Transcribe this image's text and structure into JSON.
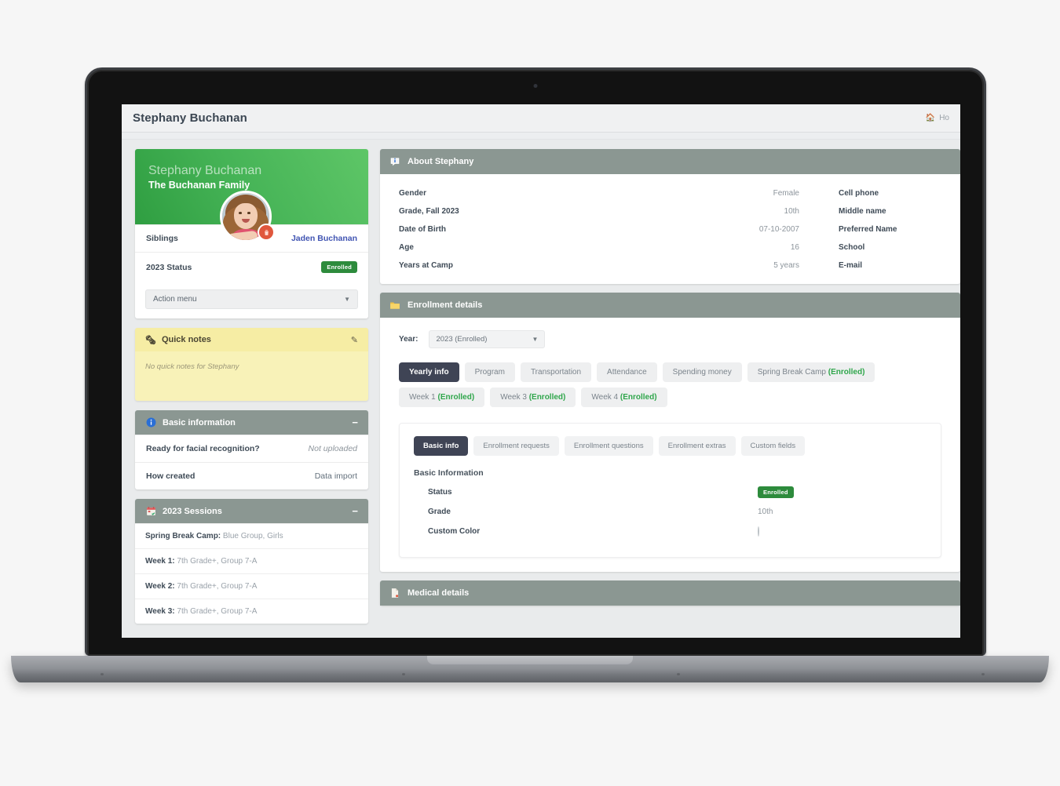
{
  "topbar": {
    "title": "Stephany Buchanan",
    "home_icon": "home-icon",
    "breadcrumb_text": "Ho"
  },
  "profile": {
    "name": "Stephany Buchanan",
    "family": "The Buchanan Family",
    "avatar_alt": "Stephany Buchanan photo",
    "delete_icon": "trash-icon",
    "rows": [
      {
        "key": "Siblings",
        "value": "Jaden Buchanan",
        "type": "link"
      },
      {
        "key": "2023 Status",
        "value": "Enrolled",
        "type": "badge"
      }
    ],
    "action_menu": {
      "label": "Action menu",
      "caret": "chevron-down-icon"
    }
  },
  "quick_notes": {
    "icon": "notepad-icon",
    "title": "Quick notes",
    "edit_icon": "edit-icon",
    "empty_text": "No quick notes for Stephany"
  },
  "basic_information": {
    "icon": "info-circle-icon",
    "title": "Basic information",
    "collapse": "−",
    "rows": [
      {
        "key": "Ready for facial recognition?",
        "value": "Not uploaded",
        "muted": true
      },
      {
        "key": "How created",
        "value": "Data import",
        "muted": false
      }
    ]
  },
  "sessions": {
    "icon": "calendar-icon",
    "title": "2023 Sessions",
    "collapse": "−",
    "rows": [
      {
        "label": "Spring Break Camp:",
        "detail": "Blue Group, Girls"
      },
      {
        "label": "Week 1:",
        "detail": "7th Grade+, Group 7-A"
      },
      {
        "label": "Week 2:",
        "detail": "7th Grade+, Group 7-A"
      },
      {
        "label": "Week 3:",
        "detail": "7th Grade+, Group 7-A"
      }
    ]
  },
  "about": {
    "icon": "speech-bubble-info-icon",
    "title": "About Stephany",
    "rows": [
      {
        "label": "Gender",
        "value": "Female",
        "label2": "Cell phone",
        "value2": ""
      },
      {
        "label": "Grade, Fall 2023",
        "value": "10th",
        "label2": "Middle name",
        "value2": ""
      },
      {
        "label": "Date of Birth",
        "value": "07-10-2007",
        "label2": "Preferred Name",
        "value2": ""
      },
      {
        "label": "Age",
        "value": "16",
        "label2": "School",
        "value2": ""
      },
      {
        "label": "Years at Camp",
        "value": "5 years",
        "label2": "E-mail",
        "value2": ""
      }
    ]
  },
  "enrollment": {
    "icon": "folder-icon",
    "title": "Enrollment details",
    "year_label": "Year:",
    "year_value": "2023 (Enrolled)",
    "year_caret": "chevron-down-icon",
    "tabs": [
      {
        "label": "Yearly info",
        "note": "",
        "active": true
      },
      {
        "label": "Program",
        "note": "",
        "active": false
      },
      {
        "label": "Transportation",
        "note": "",
        "active": false
      },
      {
        "label": "Attendance",
        "note": "",
        "active": false
      },
      {
        "label": "Spending money",
        "note": "",
        "active": false
      },
      {
        "label": "Spring Break Camp",
        "note": "(Enrolled)",
        "active": false
      },
      {
        "label": "Week 1",
        "note": "(Enrolled)",
        "active": false
      },
      {
        "label": "Week 3",
        "note": "(Enrolled)",
        "active": false
      },
      {
        "label": "Week 4",
        "note": "(Enrolled)",
        "active": false
      }
    ],
    "inner_tabs": [
      {
        "label": "Basic info",
        "active": true
      },
      {
        "label": "Enrollment requests",
        "active": false
      },
      {
        "label": "Enrollment questions",
        "active": false
      },
      {
        "label": "Enrollment extras",
        "active": false
      },
      {
        "label": "Custom fields",
        "active": false
      }
    ],
    "basic_info_heading": "Basic Information",
    "basic_info_rows": [
      {
        "label": "Status",
        "value": "Enrolled",
        "type": "badge"
      },
      {
        "label": "Grade",
        "value": "10th",
        "type": "text"
      },
      {
        "label": "Custom Color",
        "value": "",
        "type": "color"
      }
    ]
  },
  "medical": {
    "icon": "document-icon",
    "title": "Medical details"
  },
  "colors": {
    "panel_header": "#8b9792",
    "accent_green": "#2d8b3c",
    "enrolled_text": "#2fa64b",
    "active_tab": "#3f4455",
    "hero_green_dark": "#2f9e41",
    "hero_green_light": "#5ec667",
    "delete_button": "#e0573d",
    "link_blue": "#4054b2",
    "quick_notes_bg": "#f8f2b8"
  }
}
